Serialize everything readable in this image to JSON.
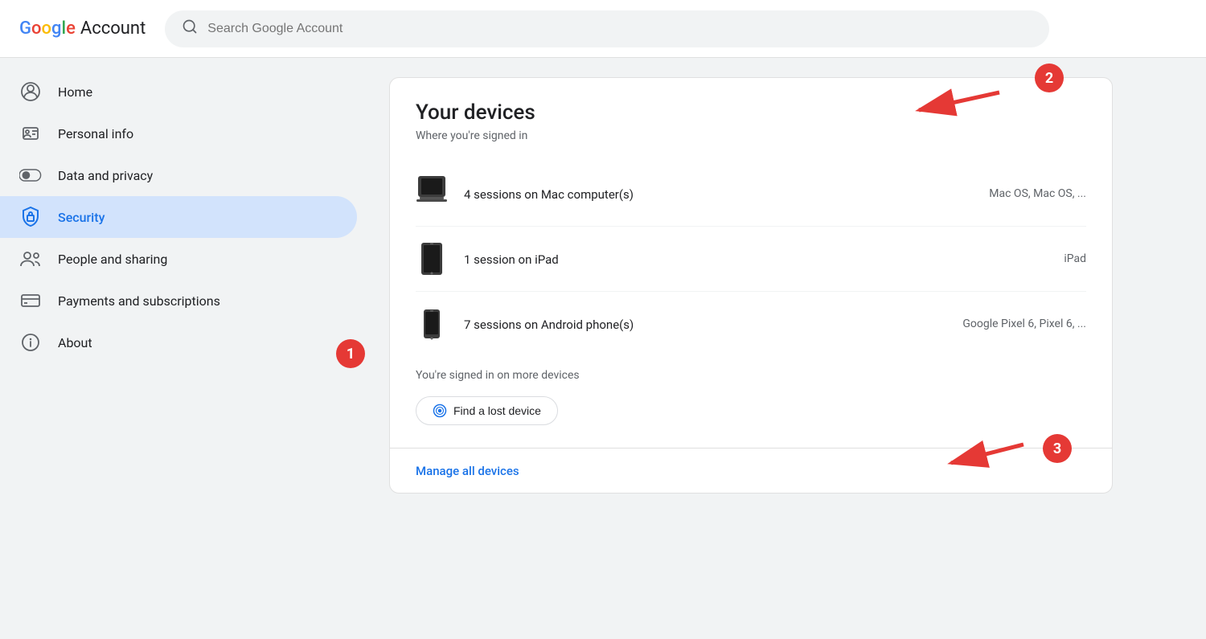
{
  "header": {
    "logo_google": "Google",
    "logo_account": "Account",
    "search_placeholder": "Search Google Account"
  },
  "sidebar": {
    "items": [
      {
        "id": "home",
        "label": "Home",
        "icon": "person-circle"
      },
      {
        "id": "personal-info",
        "label": "Personal info",
        "icon": "id-card"
      },
      {
        "id": "data-privacy",
        "label": "Data and privacy",
        "icon": "toggle"
      },
      {
        "id": "security",
        "label": "Security",
        "icon": "lock",
        "active": true
      },
      {
        "id": "people-sharing",
        "label": "People and sharing",
        "icon": "people"
      },
      {
        "id": "payments",
        "label": "Payments and subscriptions",
        "icon": "credit-card"
      },
      {
        "id": "about",
        "label": "About",
        "icon": "info-circle"
      }
    ]
  },
  "main": {
    "card": {
      "title": "Your devices",
      "subtitle": "Where you're signed in",
      "devices": [
        {
          "name": "4 sessions on Mac computer(s)",
          "detail": "Mac OS, Mac OS, ...",
          "type": "mac"
        },
        {
          "name": "1 session on iPad",
          "detail": "iPad",
          "type": "ipad"
        },
        {
          "name": "7 sessions on Android phone(s)",
          "detail": "Google Pixel 6, Pixel 6, ...",
          "type": "android"
        }
      ],
      "more_devices_text": "You're signed in on more devices",
      "find_button_label": "Find a lost device",
      "manage_link": "Manage all devices"
    },
    "annotations": [
      {
        "id": 1,
        "label": "1"
      },
      {
        "id": 2,
        "label": "2"
      },
      {
        "id": 3,
        "label": "3"
      }
    ]
  }
}
